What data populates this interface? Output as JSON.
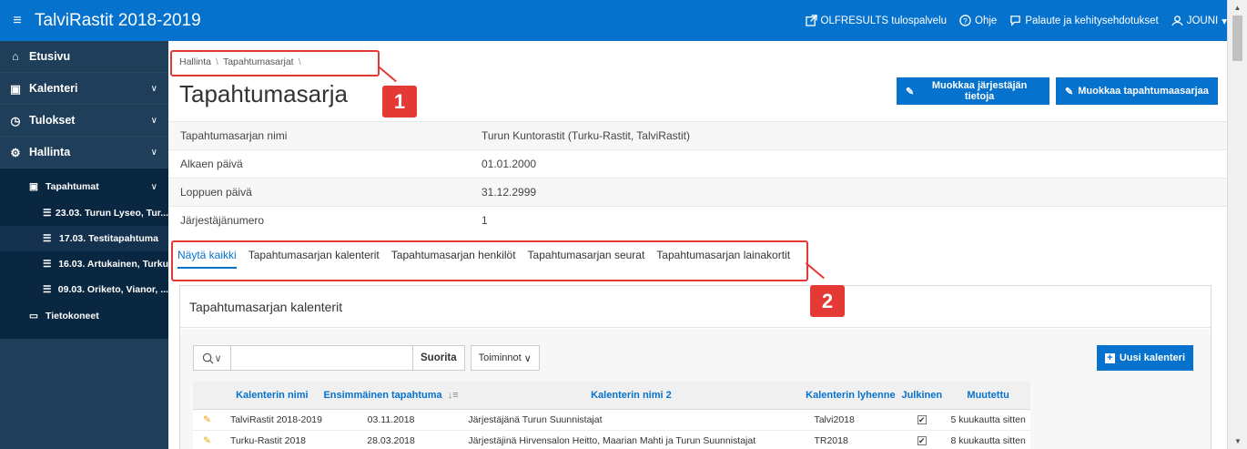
{
  "app": {
    "title": "TalviRastit 2018-2019"
  },
  "topnav": {
    "olfresults": "OLFRESULTS tulospalvelu",
    "help": "Ohje",
    "feedback": "Palaute ja kehitysehdotukset",
    "user": "JOUNI"
  },
  "sidebar": {
    "home": "Etusivu",
    "calendars": "Kalenteri",
    "results": "Tulokset",
    "admin": "Hallinta",
    "events": "Tapahtumat",
    "event_items": [
      "23.03. Turun Lyseo, Tur...",
      "17.03. Testitapahtuma",
      "16.03. Artukainen, Turku",
      "09.03. Oriketo, Vianor, ..."
    ],
    "computers": "Tietokoneet"
  },
  "breadcrumb": [
    "Hallinta",
    "Tapahtumasarjat"
  ],
  "page_title": "Tapahtumasarja",
  "buttons": {
    "edit_organizer": "Muokkaa järjestäjän tietoja",
    "edit_series": "Muokkaa tapahtumaasarjaa"
  },
  "info": [
    {
      "label": "Tapahtumasarjan nimi",
      "value": "Turun Kuntorastit (Turku-Rastit, TalviRastit)"
    },
    {
      "label": "Alkaen päivä",
      "value": "01.01.2000"
    },
    {
      "label": "Loppuen päivä",
      "value": "31.12.2999"
    },
    {
      "label": "Järjestäjänumero",
      "value": "1"
    }
  ],
  "tabs": [
    "Näytä kaikki",
    "Tapahtumasarjan kalenterit",
    "Tapahtumasarjan henkilöt",
    "Tapahtumasarjan seurat",
    "Tapahtumasarjan lainakortit"
  ],
  "region": {
    "title": "Tapahtumasarjan kalenterit",
    "go": "Suorita",
    "actions": "Toiminnot",
    "new": "Uusi kalenteri",
    "search_value": ""
  },
  "grid": {
    "columns": [
      "Kalenterin nimi",
      "Ensimmäinen tapahtuma",
      "Kalenterin nimi 2",
      "Kalenterin lyhenne",
      "Julkinen",
      "Muutettu"
    ],
    "rows": [
      {
        "name": "TalviRastit 2018-2019",
        "first": "03.11.2018",
        "name2": "Järjestäjänä Turun Suunnistajat",
        "abbr": "Talvi2018",
        "public": true,
        "modified": "5 kuukautta sitten"
      },
      {
        "name": "Turku-Rastit 2018",
        "first": "28.03.2018",
        "name2": "Järjestäjinä Hirvensalon Heitto, Maarian Mahti ja Turun Suunnistajat",
        "abbr": "TR2018",
        "public": true,
        "modified": "8 kuukautta sitten"
      }
    ]
  },
  "callouts": [
    "1",
    "2"
  ],
  "colors": {
    "brand": "#0572ce",
    "sidebar": "#1f3e59",
    "callout": "#e53935"
  }
}
